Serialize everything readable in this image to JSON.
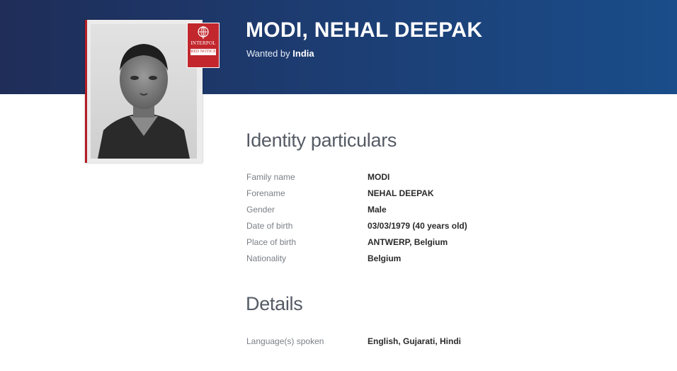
{
  "header": {
    "name": "MODI, NEHAL DEEPAK",
    "wanted_prefix": "Wanted by",
    "wanted_country": "India"
  },
  "badge": {
    "line1": "INTERPOL",
    "line2": "RED NOTICE"
  },
  "identity": {
    "title": "Identity particulars",
    "rows": [
      {
        "label": "Family name",
        "value": "MODI"
      },
      {
        "label": "Forename",
        "value": "NEHAL DEEPAK"
      },
      {
        "label": "Gender",
        "value": "Male"
      },
      {
        "label": "Date of birth",
        "value": "03/03/1979 (40 years old)"
      },
      {
        "label": "Place of birth",
        "value": "ANTWERP, Belgium"
      },
      {
        "label": "Nationality",
        "value": "Belgium"
      }
    ]
  },
  "details": {
    "title": "Details",
    "rows": [
      {
        "label": "Language(s) spoken",
        "value": "English, Gujarati, Hindi"
      }
    ]
  },
  "colors": {
    "banner": "#1d3a6e",
    "badge_red": "#c1272d"
  }
}
